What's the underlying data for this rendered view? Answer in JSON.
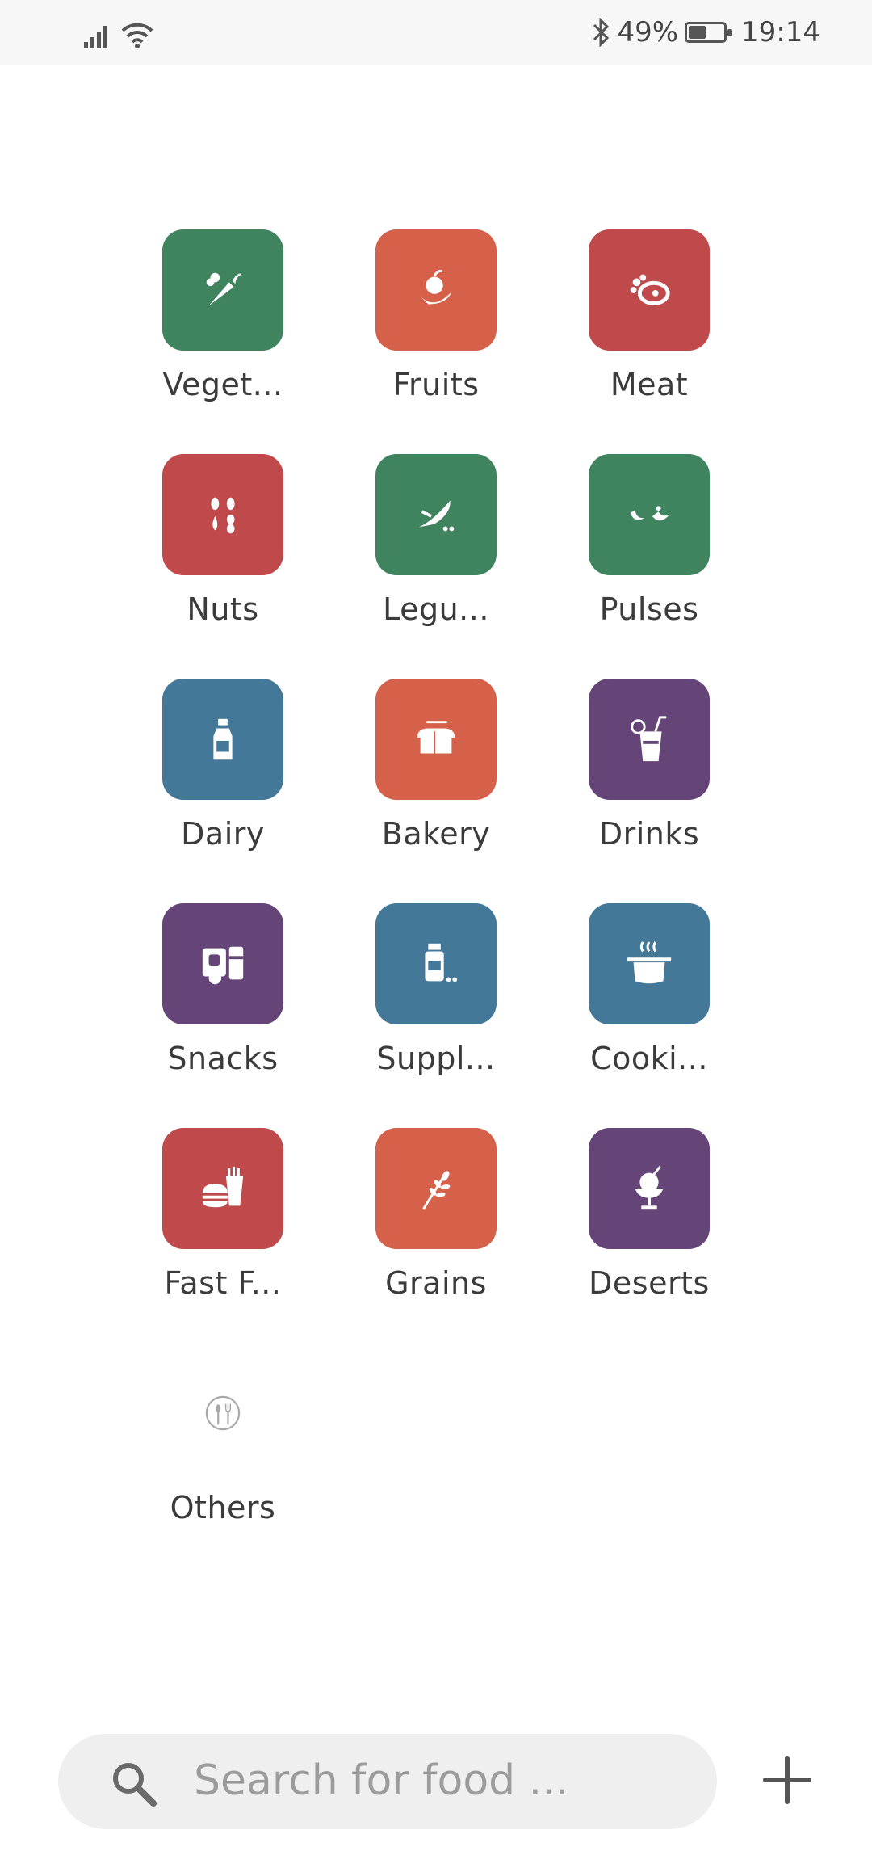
{
  "status_bar": {
    "battery_percent_text": "49%",
    "battery_level": 0.49,
    "time": "19:14",
    "icons": [
      "signal-icon",
      "wifi-icon",
      "bluetooth-icon",
      "battery-icon"
    ]
  },
  "categories": [
    {
      "label": "Veget...",
      "color": "#3f845e",
      "icon": "carrot-icon"
    },
    {
      "label": "Fruits",
      "color": "#d5614a",
      "icon": "fruit-icon"
    },
    {
      "label": "Meat",
      "color": "#c04a4b",
      "icon": "meat-icon"
    },
    {
      "label": "Nuts",
      "color": "#c04a4b",
      "icon": "nuts-icon"
    },
    {
      "label": "Legu...",
      "color": "#3f845e",
      "icon": "legume-icon"
    },
    {
      "label": "Pulses",
      "color": "#3f845e",
      "icon": "pulses-icon"
    },
    {
      "label": "Dairy",
      "color": "#447898",
      "icon": "milk-bottle-icon"
    },
    {
      "label": "Bakery",
      "color": "#d5614a",
      "icon": "bread-icon"
    },
    {
      "label": "Drinks",
      "color": "#654477",
      "icon": "drink-icon"
    },
    {
      "label": "Snacks",
      "color": "#654477",
      "icon": "snacks-icon"
    },
    {
      "label": "Suppl...",
      "color": "#447898",
      "icon": "supplement-icon"
    },
    {
      "label": "Cooki...",
      "color": "#447898",
      "icon": "cooking-pot-icon"
    },
    {
      "label": "Fast F...",
      "color": "#c04a4b",
      "icon": "fast-food-icon"
    },
    {
      "label": "Grains",
      "color": "#d5614a",
      "icon": "wheat-icon"
    },
    {
      "label": "Deserts",
      "color": "#654477",
      "icon": "ice-cream-icon"
    },
    {
      "label": "Others",
      "color": "#ffffff",
      "icon": "cutlery-icon"
    }
  ],
  "search": {
    "placeholder": "Search for food ...",
    "icon": "search-icon"
  },
  "add_button": {
    "icon": "plus-icon"
  }
}
